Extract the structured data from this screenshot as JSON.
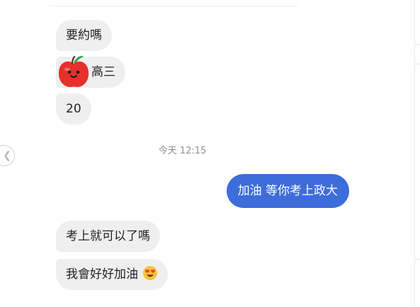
{
  "conversation": {
    "incoming_group_1": [
      {
        "text": "要約嗎"
      },
      {
        "text": "高三",
        "sticker": "apple-face-icon"
      },
      {
        "text": "20"
      }
    ],
    "timestamp": "今天 12:15",
    "outgoing": [
      {
        "text": "加油 等你考上政大"
      }
    ],
    "incoming_group_2": [
      {
        "text": "考上就可以了嗎"
      },
      {
        "text": "我會好好加油",
        "emoji": "heart-eyes-emoji-icon"
      }
    ]
  },
  "colors": {
    "incoming_bubble": "#efefef",
    "outgoing_bubble": "#3d6cdb",
    "timestamp": "#8e8e8e"
  },
  "icons": {
    "back": "chevron-left-icon"
  }
}
